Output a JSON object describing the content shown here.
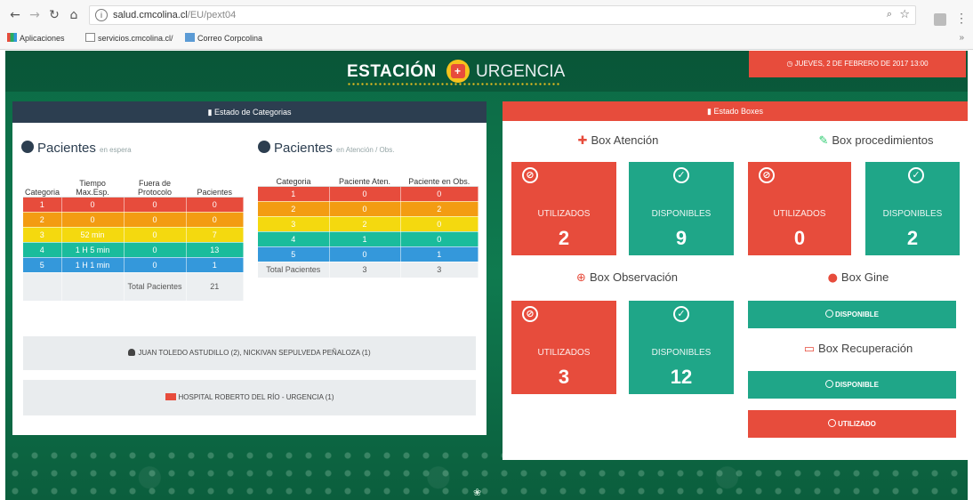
{
  "browser": {
    "url_host": "salud.cmcolina.cl",
    "url_path": "/EU/pext04",
    "bookmarks": [
      "Aplicaciones",
      "servicios.cmcolina.cl/",
      "Correo Corpcolina"
    ]
  },
  "header": {
    "brand_left": "ESTACIÓN",
    "brand_right": "URGENCIA",
    "datetime": "JUEVES, 2 DE FEBRERO DE 2017 13:00"
  },
  "categorias": {
    "panel_title": "Estado de Categorias",
    "espera": {
      "title": "Pacientes",
      "subtitle": "en espera",
      "headers": [
        "Categoria",
        "Tiempo Max.Esp.",
        "Fuera de Protocolo",
        "Pacientes"
      ],
      "rows": [
        [
          "1",
          "0",
          "0",
          "0"
        ],
        [
          "2",
          "0",
          "0",
          "0"
        ],
        [
          "3",
          "52 min",
          "0",
          "7"
        ],
        [
          "4",
          "1 H 5 min",
          "0",
          "13"
        ],
        [
          "5",
          "1 H 1 min",
          "0",
          "1"
        ]
      ],
      "total_label": "Total Pacientes",
      "total_value": "21"
    },
    "atencion": {
      "title": "Pacientes",
      "subtitle": "en Atención / Obs.",
      "headers": [
        "Categoria",
        "Paciente Aten.",
        "Paciente en Obs."
      ],
      "rows": [
        [
          "1",
          "0",
          "0"
        ],
        [
          "2",
          "0",
          "2"
        ],
        [
          "3",
          "2",
          "0"
        ],
        [
          "4",
          "1",
          "0"
        ],
        [
          "5",
          "0",
          "1"
        ]
      ],
      "total_label": "Total Pacientes",
      "total_aten": "3",
      "total_obs": "3"
    },
    "info_staff": "JUAN TOLEDO ASTUDILLO (2), NICKIVAN SEPULVEDA PEÑALOZA (1)",
    "info_hospital": "HOSPITAL ROBERTO DEL RÍO - URGENCIA (1)"
  },
  "boxes": {
    "panel_title": "Estado Boxes",
    "atencion": {
      "title": "Box Atención",
      "used_label": "UTILIZADOS",
      "used": "2",
      "free_label": "DISPONIBLES",
      "free": "9"
    },
    "procedimientos": {
      "title": "Box procedimientos",
      "used_label": "UTILIZADOS",
      "used": "0",
      "free_label": "DISPONIBLES",
      "free": "2"
    },
    "observacion": {
      "title": "Box Observación",
      "used_label": "UTILIZADOS",
      "used": "3",
      "free_label": "DISPONIBLES",
      "free": "12"
    },
    "gine": {
      "title": "Box Gine",
      "status": "DISPONIBLE"
    },
    "recuperacion": {
      "title": "Box Recuperación",
      "status_1": "DISPONIBLE",
      "status_2": "UTILIZADO"
    }
  },
  "colors": {
    "red": "#e74c3c",
    "green": "#1fa688",
    "orange": "#f39c12",
    "yellow": "#f4d90f",
    "teal": "#1abc9c",
    "blue": "#3498db",
    "navy": "#2c3e50"
  }
}
